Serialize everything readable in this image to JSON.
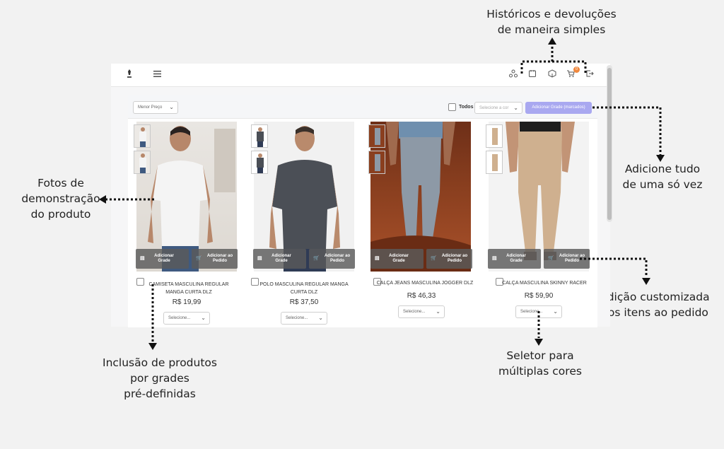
{
  "annotations": {
    "history": [
      "Históricos e devoluções",
      "de maneira simples"
    ],
    "add_all": [
      "Adicione tudo",
      "de uma só vez"
    ],
    "photos": [
      "Fotos de",
      "demonstração",
      "do produto"
    ],
    "custom": [
      "Adição customizada",
      "dos itens ao pedido"
    ],
    "grades": [
      "Inclusão de produtos",
      "por grades",
      "pré-definidas"
    ],
    "colors": [
      "Seletor para",
      "múltiplas cores"
    ]
  },
  "topbar": {
    "cart_count": "0"
  },
  "filters": {
    "sort_value": "Menor Preço",
    "todos_label": "Todos",
    "color_placeholder": "Selecione a cor",
    "add_grade_button": "Adicionar Grade (marcados)"
  },
  "card_buttons": {
    "add_grade": "Adicionar Grade",
    "add_order": "Adicionar ao Pedido"
  },
  "products": [
    {
      "name": "CAMISETA MASCULINA REGULAR MANGA CURTA DLZ",
      "price": "R$ 19,99",
      "select": "Selecione..."
    },
    {
      "name": "POLO MASCULINA REGULAR MANGA CURTA DLZ",
      "price": "R$ 37,50",
      "select": "Selecione..."
    },
    {
      "name": "CALÇA JEANS MASCULINA JOGGER DLZ",
      "price": "R$ 46,33",
      "select": "Selecione..."
    },
    {
      "name": "CALÇA MASCULINA SKINNY RACER",
      "price": "R$ 59,90",
      "select": "Selecione..."
    }
  ],
  "colors": {
    "accent": "#a9a8f0",
    "badge": "#f0883e",
    "background": "#f2f2f2"
  }
}
